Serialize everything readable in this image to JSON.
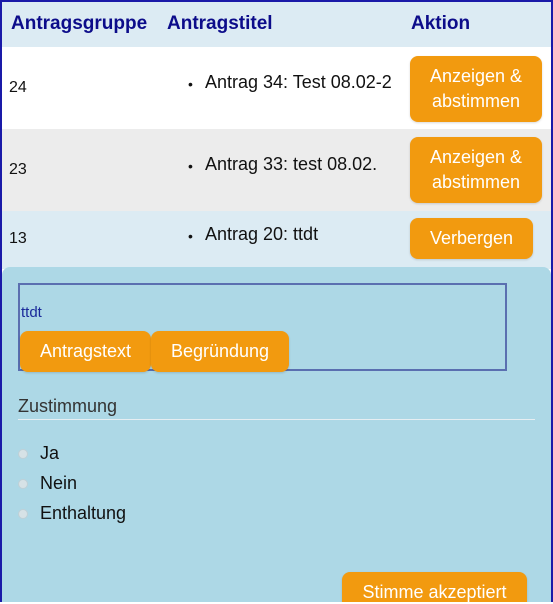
{
  "table": {
    "headers": {
      "group": "Antragsgruppe",
      "title": "Antragstitel",
      "action": "Aktion"
    },
    "rows": [
      {
        "group": "24",
        "title": "Antrag 34: Test 08.02-2",
        "action": "Anzeigen & abstimmen"
      },
      {
        "group": "23",
        "title": "Antrag 33: test 08.02.",
        "action": "Anzeigen & abstimmen"
      },
      {
        "group": "13",
        "title": "Antrag 20: ttdt",
        "action": "Verbergen"
      }
    ]
  },
  "panel": {
    "motion_name": "ttdt",
    "buttons": {
      "text": "Antragstext",
      "reason": "Begründung"
    },
    "vote": {
      "title": "Zustimmung",
      "options": [
        "Ja",
        "Nein",
        "Enthaltung"
      ],
      "submit": "Stimme akzeptiert"
    }
  },
  "colors": {
    "accent": "#f29a0f",
    "header_text": "#0c0c8a",
    "header_bg": "#dcebf3",
    "panel_bg": "#add8e6"
  }
}
